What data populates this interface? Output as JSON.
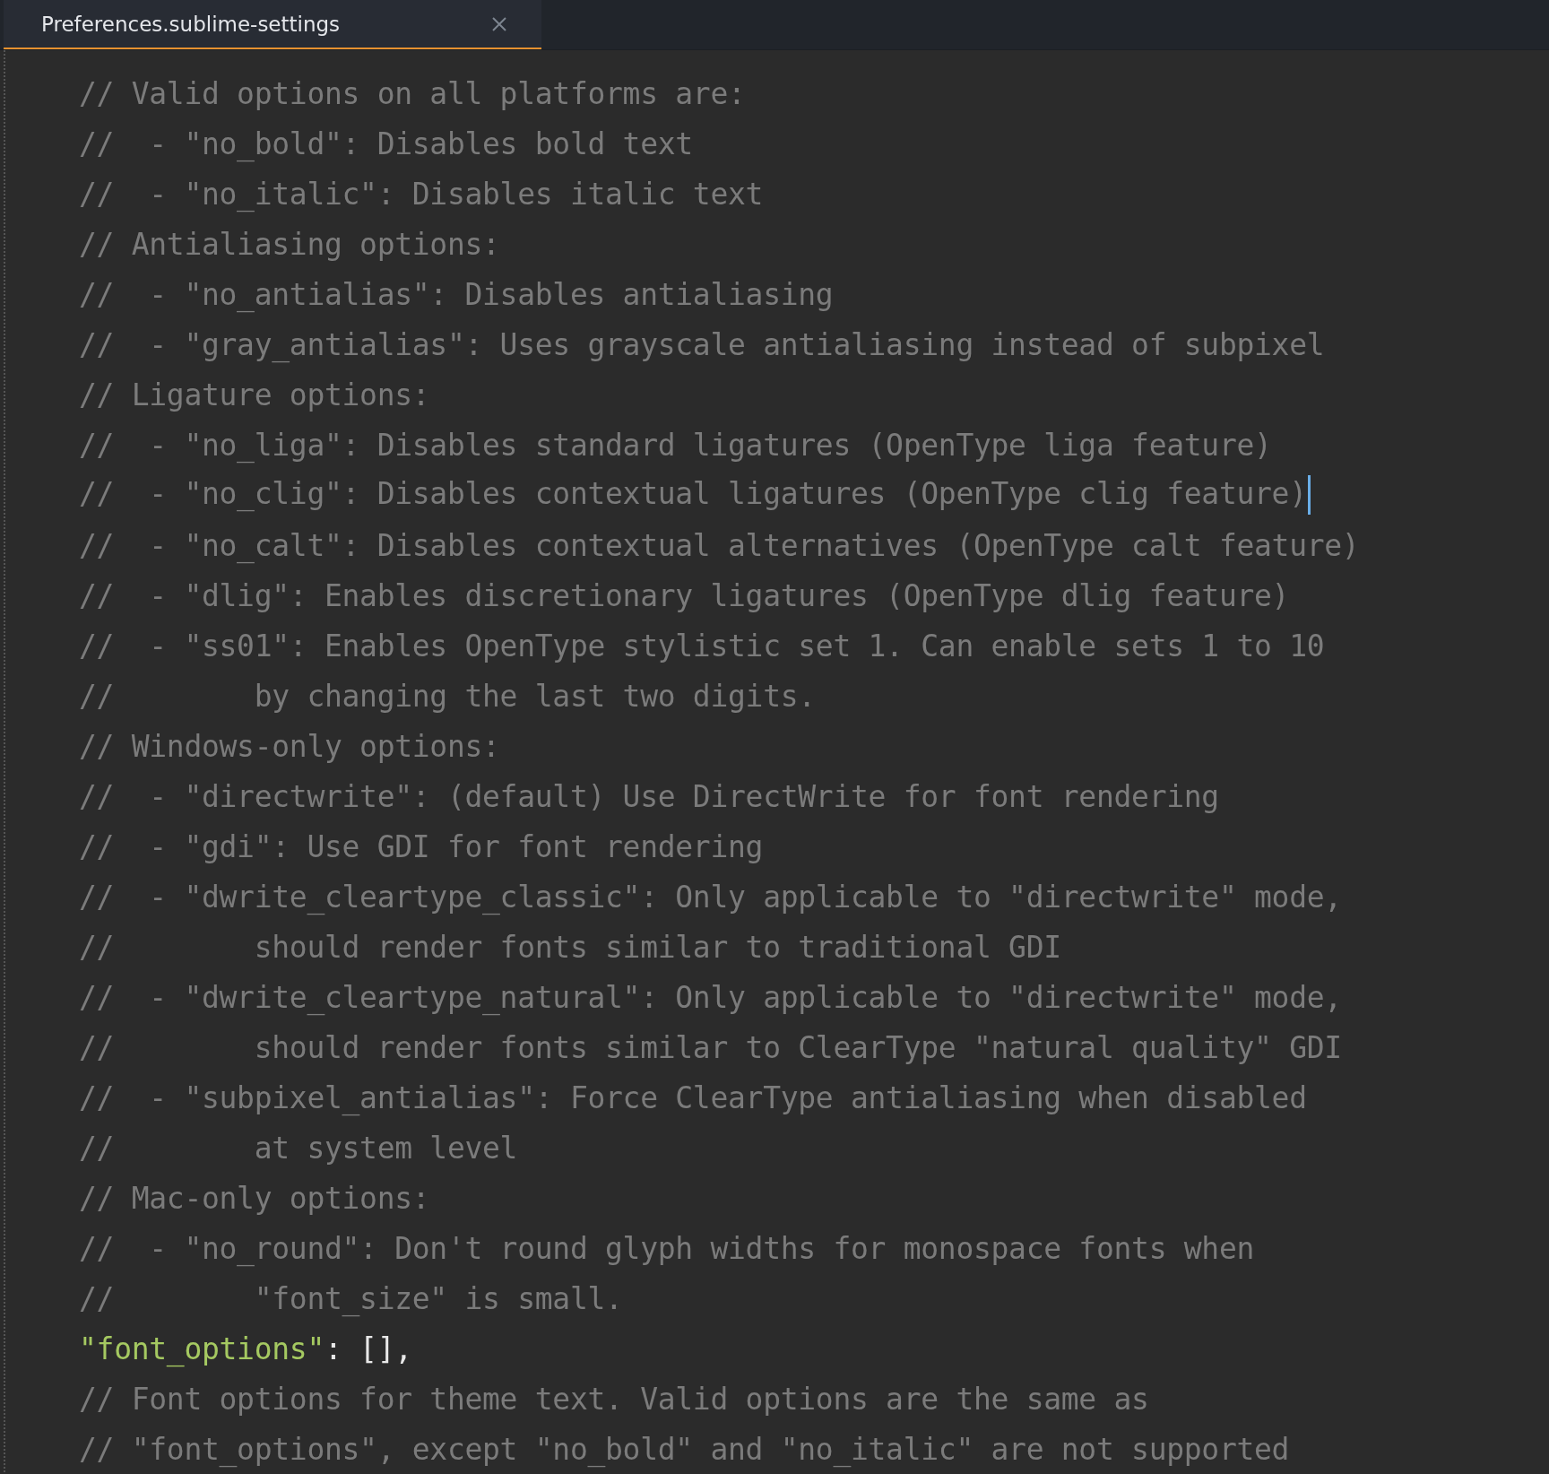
{
  "tabs": [
    {
      "label": "Preferences.sublime-settings",
      "selected": true
    }
  ],
  "editor": {
    "lines": [
      {
        "kind": "comment",
        "text": "// Valid options on all platforms are:",
        "cursor": false
      },
      {
        "kind": "comment",
        "text": "//  - \"no_bold\": Disables bold text",
        "cursor": false
      },
      {
        "kind": "comment",
        "text": "//  - \"no_italic\": Disables italic text",
        "cursor": false
      },
      {
        "kind": "comment",
        "text": "// Antialiasing options:",
        "cursor": false
      },
      {
        "kind": "comment",
        "text": "//  - \"no_antialias\": Disables antialiasing",
        "cursor": false
      },
      {
        "kind": "comment",
        "text": "//  - \"gray_antialias\": Uses grayscale antialiasing instead of subpixel",
        "cursor": false
      },
      {
        "kind": "comment",
        "text": "// Ligature options:",
        "cursor": false
      },
      {
        "kind": "comment",
        "text": "//  - \"no_liga\": Disables standard ligatures (OpenType liga feature)",
        "cursor": false
      },
      {
        "kind": "comment",
        "text": "//  - \"no_clig\": Disables contextual ligatures (OpenType clig feature)",
        "cursor": true
      },
      {
        "kind": "comment",
        "text": "//  - \"no_calt\": Disables contextual alternatives (OpenType calt feature)",
        "cursor": false
      },
      {
        "kind": "comment",
        "text": "//  - \"dlig\": Enables discretionary ligatures (OpenType dlig feature)",
        "cursor": false
      },
      {
        "kind": "comment",
        "text": "//  - \"ss01\": Enables OpenType stylistic set 1. Can enable sets 1 to 10",
        "cursor": false
      },
      {
        "kind": "comment",
        "text": "//        by changing the last two digits.",
        "cursor": false
      },
      {
        "kind": "comment",
        "text": "// Windows-only options:",
        "cursor": false
      },
      {
        "kind": "comment",
        "text": "//  - \"directwrite\": (default) Use DirectWrite for font rendering",
        "cursor": false
      },
      {
        "kind": "comment",
        "text": "//  - \"gdi\": Use GDI for font rendering",
        "cursor": false
      },
      {
        "kind": "comment",
        "text": "//  - \"dwrite_cleartype_classic\": Only applicable to \"directwrite\" mode,",
        "cursor": false
      },
      {
        "kind": "comment",
        "text": "//        should render fonts similar to traditional GDI",
        "cursor": false
      },
      {
        "kind": "comment",
        "text": "//  - \"dwrite_cleartype_natural\": Only applicable to \"directwrite\" mode,",
        "cursor": false
      },
      {
        "kind": "comment",
        "text": "//        should render fonts similar to ClearType \"natural quality\" GDI",
        "cursor": false
      },
      {
        "kind": "comment",
        "text": "//  - \"subpixel_antialias\": Force ClearType antialiasing when disabled",
        "cursor": false
      },
      {
        "kind": "comment",
        "text": "//        at system level",
        "cursor": false
      },
      {
        "kind": "comment",
        "text": "// Mac-only options:",
        "cursor": false
      },
      {
        "kind": "comment",
        "text": "//  - \"no_round\": Don't round glyph widths for monospace fonts when",
        "cursor": false
      },
      {
        "kind": "comment",
        "text": "//        \"font_size\" is small.",
        "cursor": false
      },
      {
        "kind": "setting",
        "key": "\"font_options\"",
        "text": ": [],",
        "cursor": false
      },
      {
        "kind": "comment",
        "text": "// Font options for theme text. Valid options are the same as",
        "cursor": false
      },
      {
        "kind": "comment",
        "text": "// \"font_options\", except \"no_bold\" and \"no_italic\" are not supported",
        "cursor": false
      }
    ]
  }
}
